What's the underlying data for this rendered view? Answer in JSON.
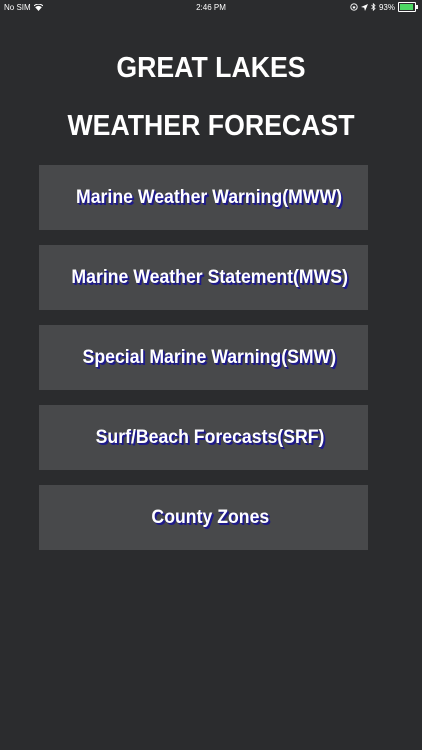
{
  "status_bar": {
    "carrier": "No SIM",
    "time": "2:46 PM",
    "battery_percent_text": "93%",
    "battery_level": 0.93
  },
  "title": {
    "line1": "GREAT LAKES",
    "line2": "WEATHER FORECAST"
  },
  "menu": [
    {
      "label": "Marine Weather Warning(MWW)"
    },
    {
      "label": "Marine Weather Statement(MWS)"
    },
    {
      "label": "Special Marine Warning(SMW)"
    },
    {
      "label": "Surf/Beach Forecasts(SRF)"
    },
    {
      "label": "County Zones"
    }
  ],
  "colors": {
    "background": "#2b2c2e",
    "button": "#48494b",
    "label_shadow": "#1e1a8a",
    "battery": "#4cd964"
  }
}
